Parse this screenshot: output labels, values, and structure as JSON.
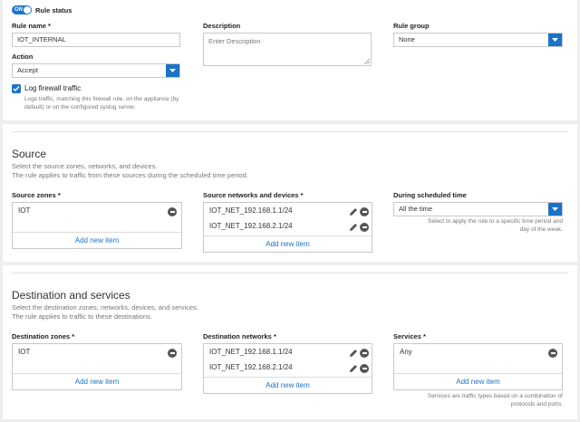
{
  "rule": {
    "status_toggle": "ON",
    "status_label": "Rule status",
    "name_label": "Rule name",
    "name_value": "IOT_INTERNAL",
    "description_label": "Description",
    "description_placeholder": "Enter Description",
    "group_label": "Rule group",
    "group_value": "None",
    "action_label": "Action",
    "action_value": "Accept",
    "log_label": "Log firewall traffic",
    "log_checked": true,
    "log_help_1": "Logs traffic, matching this firewall rule, on the appliance (by",
    "log_help_2": "default) or on the configured syslog server."
  },
  "required_marker": "*",
  "source": {
    "title": "Source",
    "desc_1": "Select the source zones, networks, and devices.",
    "desc_2": "The rule applies to traffic from these sources during the scheduled time period.",
    "zones_label": "Source zones",
    "zones": [
      "IOT"
    ],
    "networks_label": "Source networks and devices",
    "networks": [
      "IOT_NET_192.168.1.1/24",
      "IOT_NET_192.168.2.1/24"
    ],
    "schedule_label": "During scheduled time",
    "schedule_value": "All the time",
    "schedule_help_1": "Select to apply the rule to a specific time period and",
    "schedule_help_2": "day of the week.",
    "add_new": "Add new item"
  },
  "destination": {
    "title": "Destination and services",
    "desc_1": "Select the destination zones, networks, devices, and services.",
    "desc_2": "The rule applies to traffic to these destinations.",
    "zones_label": "Destination zones",
    "zones": [
      "IOT"
    ],
    "networks_label": "Destination networks",
    "networks": [
      "IOT_NET_192.168.1.1/24",
      "IOT_NET_192.168.2.1/24"
    ],
    "services_label": "Services",
    "services": [
      "Any"
    ],
    "services_help_1": "Services are traffic types based on a combination of",
    "services_help_2": "protocols and ports.",
    "add_new": "Add new item"
  },
  "colors": {
    "accent": "#1a73c9",
    "background": "#eeeeee",
    "panel": "#ffffff"
  }
}
